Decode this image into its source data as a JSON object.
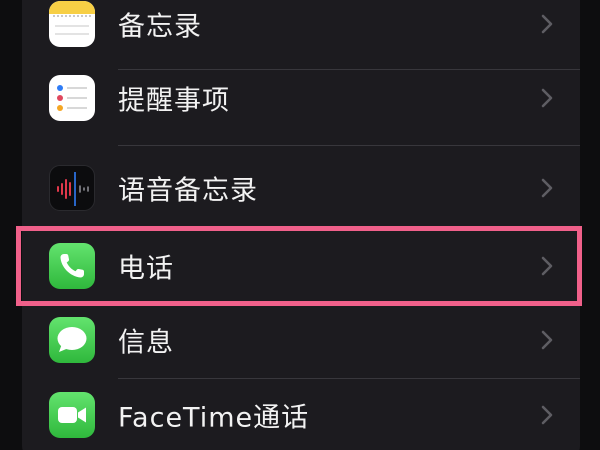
{
  "settings_list": {
    "items": [
      {
        "label": "备忘录",
        "icon": "notes-icon"
      },
      {
        "label": "提醒事项",
        "icon": "reminders-icon"
      },
      {
        "label": "语音备忘录",
        "icon": "voice-memos-icon"
      },
      {
        "label": "电话",
        "icon": "phone-icon",
        "highlighted": true
      },
      {
        "label": "信息",
        "icon": "messages-icon"
      },
      {
        "label": "FaceTime通话",
        "icon": "facetime-icon"
      }
    ]
  },
  "colors": {
    "background": "#0d0d0f",
    "group": "#1c1b1f",
    "text": "#f2f2f2",
    "chevron": "#5e5d63",
    "highlight_border": "#f0608a",
    "app_green": "#34c759"
  }
}
